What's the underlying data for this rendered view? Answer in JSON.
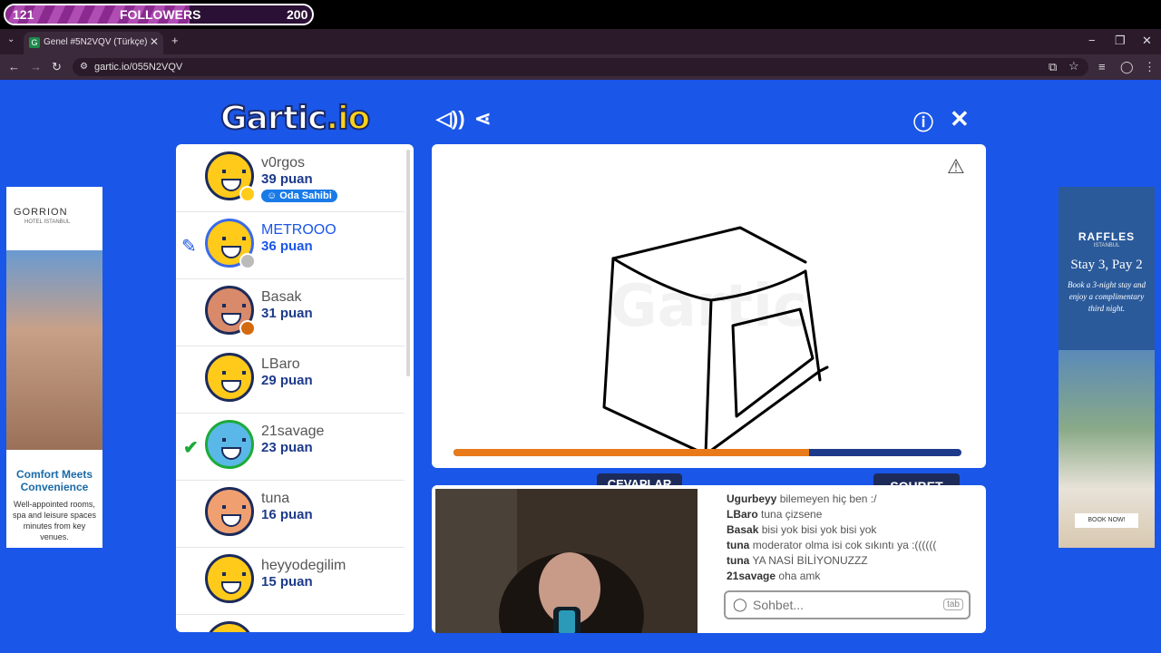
{
  "followers": {
    "current": "121",
    "label": "FOLLOWERS",
    "goal": "200",
    "progress": 0.6
  },
  "browser": {
    "tab_title": "Genel #5N2VQV (Türkçe) - Gart",
    "url": "gartic.io/055N2VQV"
  },
  "logo": {
    "main": "Gartic",
    "io": ".io"
  },
  "players": [
    {
      "name": "v0rgos",
      "score": "39 puan",
      "badge": "Oda Sahibi",
      "status": "#ffcc1a"
    },
    {
      "name": "METROOO",
      "score": "36 puan",
      "status": "#bbbbbb",
      "drawing": true
    },
    {
      "name": "Basak",
      "score": "31 puan",
      "status": "#d46a10"
    },
    {
      "name": "LBaro",
      "score": "29 puan"
    },
    {
      "name": "21savage",
      "score": "23 puan",
      "guessed": true
    },
    {
      "name": "tuna",
      "score": "16 puan"
    },
    {
      "name": "heyyodegilim",
      "score": "15 puan"
    }
  ],
  "canvas": {
    "timer_fraction": 0.7
  },
  "tabs": {
    "answers": "CEVAPLAR",
    "chat": "SOHBET"
  },
  "chat": {
    "messages": [
      {
        "user": "Ugurbeyy",
        "text": "bilemeyen hiç ben :/"
      },
      {
        "user": "LBaro",
        "text": "tuna çizsene"
      },
      {
        "user": "Basak",
        "text": "bisi yok bisi yok bisi yok"
      },
      {
        "user": "tuna",
        "text": "moderator olma isi cok sıkıntı ya :(((((("
      },
      {
        "user": "tuna",
        "text": "YA NASİ BİLİYONUZZZ"
      },
      {
        "user": "21savage",
        "text": "oha amk"
      }
    ],
    "placeholder": "Sohbet...",
    "tab_key": "tab"
  },
  "ad_left": {
    "brand": "GORRION",
    "sub": "HOTEL ISTANBUL",
    "headline": "Comfort Meets Convenience",
    "body": "Well-appointed rooms, spa and leisure spaces minutes from key venues."
  },
  "ad_right": {
    "brand": "RAFFLES",
    "sub": "ISTANBUL",
    "headline": "Stay 3, Pay 2",
    "body": "Book a 3-night stay and enjoy a complimentary third night.",
    "cta": "BOOK NOW!"
  }
}
